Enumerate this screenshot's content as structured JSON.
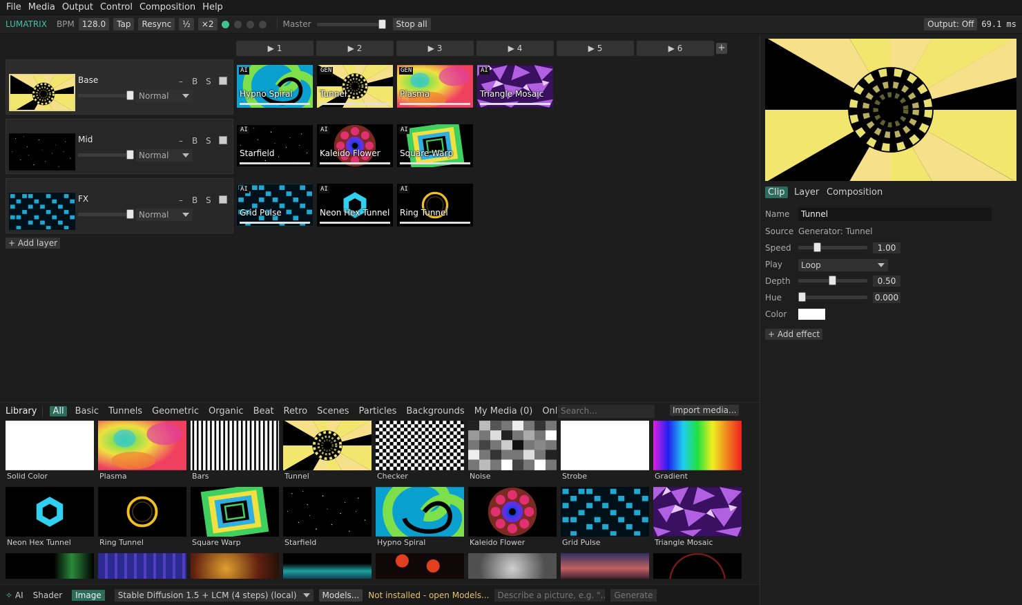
{
  "menu": [
    "File",
    "Media",
    "Output",
    "Control",
    "Composition",
    "Help"
  ],
  "toolbar": {
    "brand": "LUMATRIX",
    "bpm_label": "BPM",
    "bpm_value": "128.0",
    "tap": "Tap",
    "resync": "Resync",
    "half": "½",
    "double": "×2",
    "master_label": "Master",
    "stop_all": "Stop all",
    "output": "Output: Off",
    "frame_time": "69.1 ms"
  },
  "columns": [
    "▶ 1",
    "▶ 2",
    "▶ 3",
    "▶ 4",
    "▶ 5",
    "▶ 6"
  ],
  "add_column": "+",
  "layers": [
    {
      "name": "Base",
      "blend": "Normal",
      "b": "B",
      "s": "S",
      "minus": "–"
    },
    {
      "name": "Mid",
      "blend": "Normal",
      "b": "B",
      "s": "S",
      "minus": "–"
    },
    {
      "name": "FX",
      "blend": "Normal",
      "b": "B",
      "s": "S",
      "minus": "–"
    }
  ],
  "add_layer": "+ Add layer",
  "clips": [
    [
      {
        "badge": "AI",
        "name": "Hypno Spiral"
      },
      {
        "badge": "GEN",
        "name": "Tunnel"
      },
      {
        "badge": "GEN",
        "name": "Plasma"
      },
      {
        "badge": "AI",
        "name": "Triangle Mosaic"
      }
    ],
    [
      {
        "badge": "AI",
        "name": "Starfield"
      },
      {
        "badge": "AI",
        "name": "Kaleido Flower"
      },
      {
        "badge": "AI",
        "name": "Square Warp"
      }
    ],
    [
      {
        "badge": "AI",
        "name": "Grid Pulse"
      },
      {
        "badge": "AI",
        "name": "Neon Hex Tunnel"
      },
      {
        "badge": "AI",
        "name": "Ring Tunnel"
      }
    ]
  ],
  "inspector": {
    "tabs": [
      "Clip",
      "Layer",
      "Composition"
    ],
    "name_label": "Name",
    "name_value": "Tunnel",
    "source_label": "Source",
    "source_value": "Generator: Tunnel",
    "speed_label": "Speed",
    "speed_value": "1.00",
    "play_label": "Play",
    "play_value": "Loop",
    "depth_label": "Depth",
    "depth_value": "0.50",
    "hue_label": "Hue",
    "hue_value": "0.000",
    "color_label": "Color",
    "add_effect": "+ Add effect"
  },
  "library": {
    "title": "Library",
    "tabs": [
      "All",
      "Basic",
      "Tunnels",
      "Geometric",
      "Organic",
      "Beat",
      "Retro",
      "Scenes",
      "Particles",
      "Backgrounds",
      "My Media (0)",
      "Online"
    ],
    "search_placeholder": "Search...",
    "import": "Import media...",
    "row1": [
      "Solid Color",
      "Plasma",
      "Bars",
      "Tunnel",
      "Checker",
      "Noise",
      "Strobe",
      "Gradient"
    ],
    "row2": [
      "Neon Hex Tunnel",
      "Ring Tunnel",
      "Square Warp",
      "Starfield",
      "Hypno Spiral",
      "Kaleido Flower",
      "Grid Pulse",
      "Triangle Mosaic"
    ]
  },
  "status": {
    "ai": "AI",
    "shader": "Shader",
    "image": "Image",
    "model": "Stable Diffusion 1.5 + LCM (4 steps) (local)",
    "models_btn": "Models...",
    "warning": "Not installed - open Models...",
    "describe_placeholder": "Describe a picture, e.g. \"...",
    "generate": "Generate"
  },
  "colors": {
    "accent": "#3fc4a4",
    "tunnel_yellow": "#f5e07a",
    "warning": "#e6c070"
  }
}
